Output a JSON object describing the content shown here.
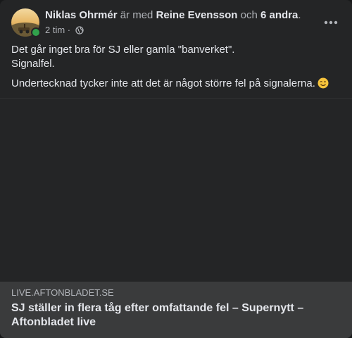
{
  "post": {
    "author": "Niklas Ohrmér",
    "with_text": " är med ",
    "tagged": "Reine Evensson",
    "and_text": " och ",
    "others": "6 andra",
    "period": ".",
    "timestamp": "2 tim",
    "dot": " · ",
    "privacy_icon": "globe-icon",
    "menu_icon": "more-horizontal-icon",
    "lines": [
      "Det går inget bra för SJ eller gamla \"banverket\".",
      "Signalfel.",
      "Undertecknad tycker inte att det är något större fel på signalerna."
    ],
    "emoji": "winking-face-icon"
  },
  "link": {
    "domain": "LIVE.AFTONBLADET.SE",
    "title": "SJ ställer in flera tåg efter omfattande fel – Supernytt – Aftonbladet live"
  },
  "colors": {
    "background": "#242526",
    "text_primary": "#e4e6eb",
    "text_secondary": "#b0b3b8",
    "link_bg": "#3a3b3c",
    "online": "#31a24c"
  }
}
